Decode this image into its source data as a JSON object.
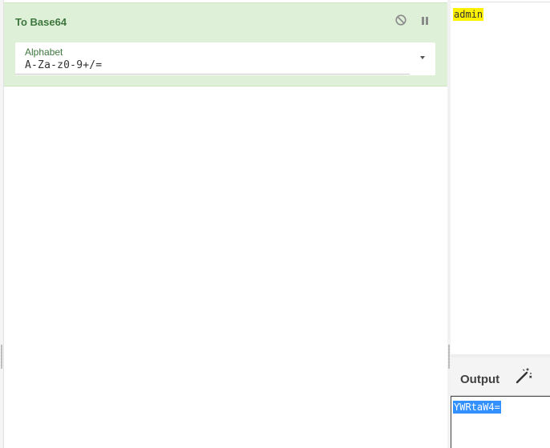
{
  "recipe": {
    "operation": {
      "title": "To Base64",
      "disable_icon": "disable-circle-icon",
      "pause_icon": "pause-icon",
      "argument": {
        "label": "Alphabet",
        "value": "A-Za-z0-9+/="
      }
    }
  },
  "input": {
    "text": "admin",
    "highlight_color": "#fff200"
  },
  "output": {
    "title": "Output",
    "magic_icon": "magic-wand-icon",
    "text": "YWRtaW4=",
    "selection_color": "#3390ff"
  },
  "colors": {
    "operation_bg": "#dff0d8",
    "operation_text": "#3c763d"
  }
}
